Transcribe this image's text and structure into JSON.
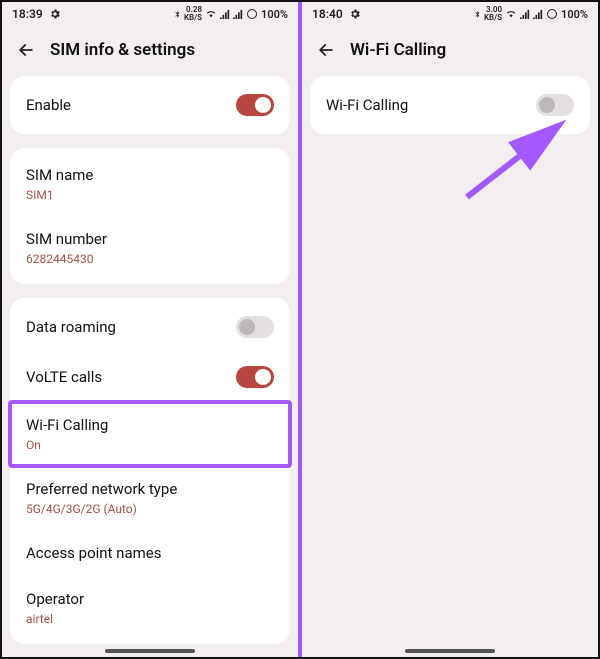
{
  "left": {
    "status": {
      "time": "18:39",
      "speed_top": "0.28",
      "speed_bot": "KB/S",
      "battery": "100%"
    },
    "header": {
      "title": "SIM info & settings"
    },
    "card1": {
      "enable": {
        "label": "Enable",
        "state": "on"
      }
    },
    "card2": {
      "sim_name": {
        "label": "SIM name",
        "value": "SIM1"
      },
      "sim_number": {
        "label": "SIM number",
        "value": "6282445430"
      }
    },
    "card3": {
      "data_roaming": {
        "label": "Data roaming",
        "state": "off"
      },
      "volte": {
        "label": "VoLTE calls",
        "state": "on"
      },
      "wifi_calling": {
        "label": "Wi-Fi Calling",
        "value": "On"
      },
      "pref_network": {
        "label": "Preferred network type",
        "value": "5G/4G/3G/2G (Auto)"
      },
      "apn": {
        "label": "Access point names"
      },
      "operator": {
        "label": "Operator",
        "value": "airtel"
      }
    }
  },
  "right": {
    "status": {
      "time": "18:40",
      "speed_top": "3.00",
      "speed_bot": "KB/S",
      "battery": "100%"
    },
    "header": {
      "title": "Wi-Fi Calling"
    },
    "card1": {
      "wifi_calling": {
        "label": "Wi-Fi Calling",
        "state": "off"
      }
    }
  }
}
